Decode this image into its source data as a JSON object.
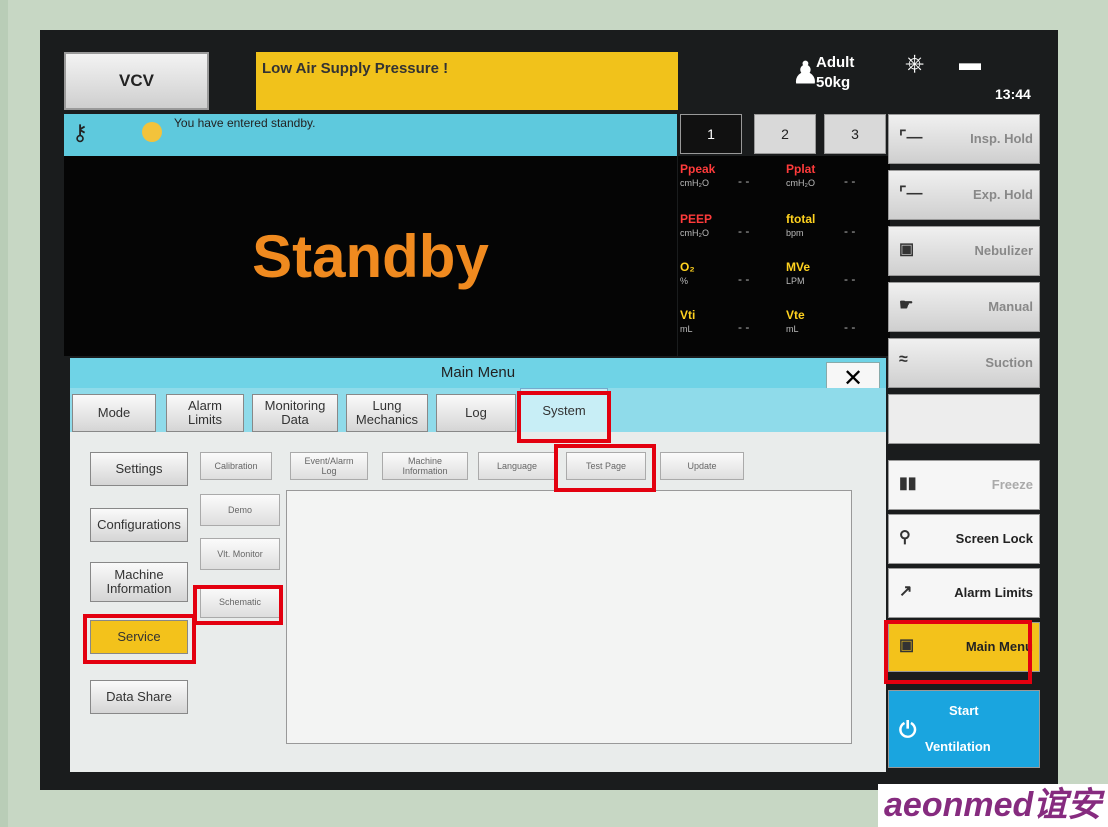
{
  "header": {
    "mode": "VCV",
    "alarm_message": "Low Air Supply Pressure !",
    "patient_type": "Adult",
    "patient_weight": "50kg",
    "time": "13:44"
  },
  "info_bar": {
    "message": "You have entered standby."
  },
  "status": {
    "main_text": "Standby"
  },
  "param_tabs": [
    "1",
    "2",
    "3"
  ],
  "parameters": [
    {
      "name": "Ppeak",
      "unit": "cmH₂O",
      "value": "- -",
      "color": "#ff3b3b"
    },
    {
      "name": "Pplat",
      "unit": "cmH₂O",
      "value": "- -",
      "color": "#ff3b3b"
    },
    {
      "name": "PEEP",
      "unit": "cmH₂O",
      "value": "- -",
      "color": "#ff3b3b"
    },
    {
      "name": "ftotal",
      "unit": "bpm",
      "value": "- -",
      "color": "#ffd21f"
    },
    {
      "name": "O₂",
      "unit": "%",
      "value": "- -",
      "color": "#ffd21f"
    },
    {
      "name": "MVe",
      "unit": "LPM",
      "value": "- -",
      "color": "#ffd21f"
    },
    {
      "name": "Vti",
      "unit": "mL",
      "value": "- -",
      "color": "#ffd21f"
    },
    {
      "name": "Vte",
      "unit": "mL",
      "value": "- -",
      "color": "#ffd21f"
    }
  ],
  "main_menu": {
    "title": "Main Menu",
    "close": "✕",
    "tabs": [
      "Mode",
      "Alarm\nLimits",
      "Monitoring\nData",
      "Lung\nMechanics",
      "Log",
      "System"
    ],
    "sub_tabs": [
      "Calibration",
      "Event/Alarm\nLog",
      "Machine\nInformation",
      "Language",
      "Test Page",
      "Update"
    ],
    "left_items": [
      "Settings",
      "Configurations",
      "Machine\nInformation",
      "Service",
      "Data Share"
    ],
    "service_items": [
      "Demo",
      "Vlt. Monitor",
      "Schematic"
    ]
  },
  "right_panel": {
    "insp_hold": "Insp. Hold",
    "exp_hold": "Exp. Hold",
    "nebulizer": "Nebulizer",
    "manual": "Manual",
    "suction": "Suction",
    "freeze": "Freeze",
    "screen_lock": "Screen Lock",
    "alarm_limits": "Alarm Limits",
    "main_menu": "Main Menu",
    "start": "Start",
    "ventilation": "Ventilation"
  },
  "brand": "aeonmed谊安",
  "colors": {
    "alarm": "#f1c21b",
    "accent": "#5ec9dd",
    "standby_text": "#f08a1f",
    "highlight": "#e3000f"
  }
}
